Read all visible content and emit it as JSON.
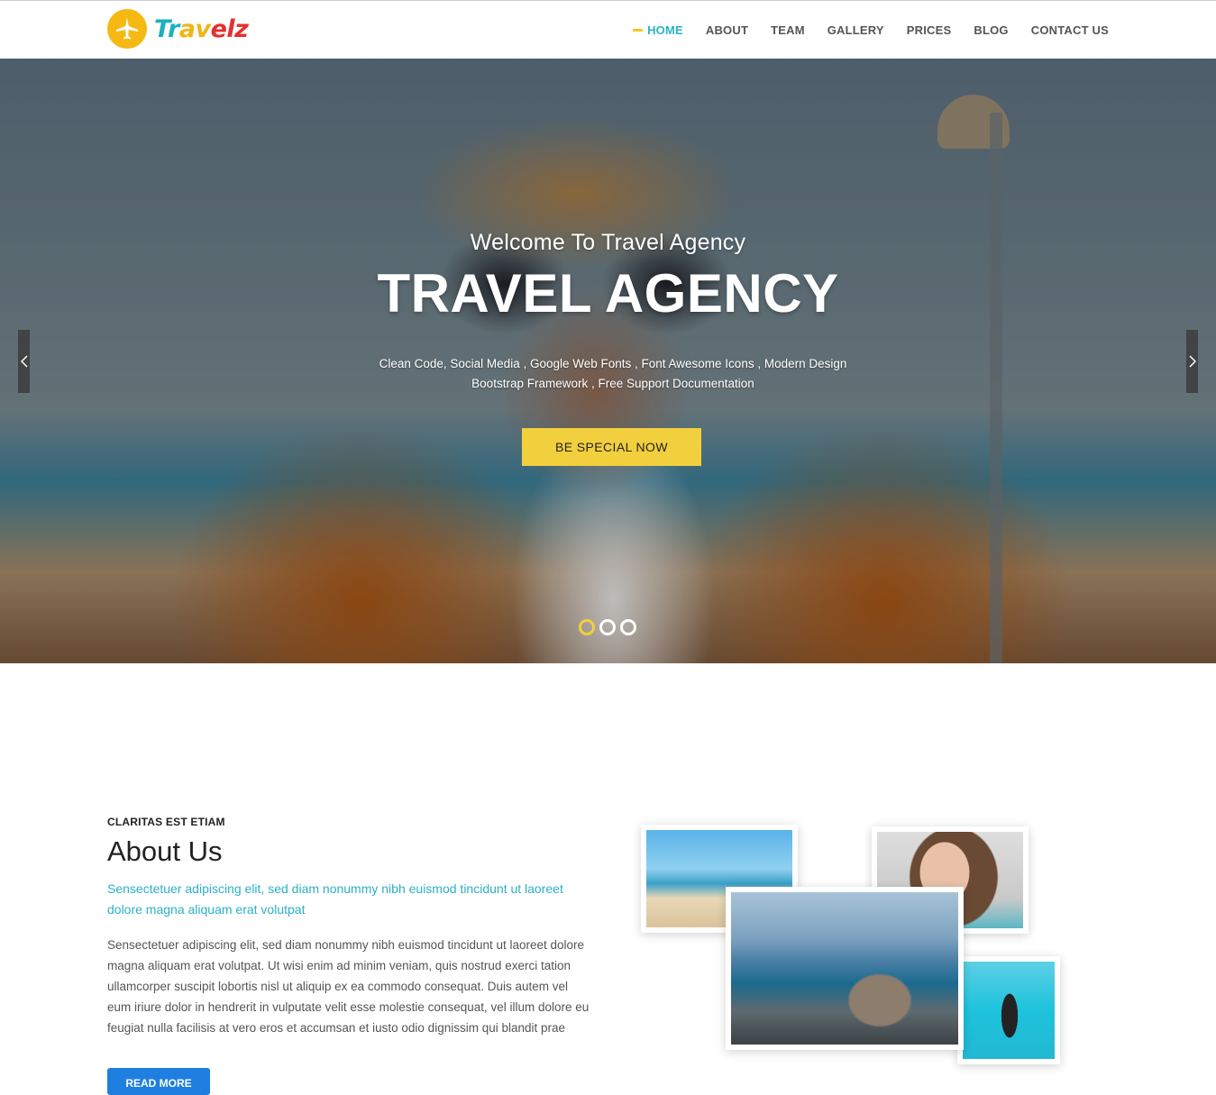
{
  "brand": {
    "name_part1": "Tr",
    "name_part2": "av",
    "name_part3": "elz",
    "colors": {
      "teal": "#19b1c0",
      "yellow": "#f0b515",
      "red": "#e5302f"
    }
  },
  "nav": {
    "items": [
      {
        "label": "HOME",
        "active": true
      },
      {
        "label": "ABOUT",
        "active": false
      },
      {
        "label": "TEAM",
        "active": false
      },
      {
        "label": "GALLERY",
        "active": false
      },
      {
        "label": "PRICES",
        "active": false
      },
      {
        "label": "BLOG",
        "active": false
      },
      {
        "label": "CONTACT US",
        "active": false
      }
    ],
    "active_color": "#2ab3c5"
  },
  "hero": {
    "subtitle": "Welcome To Travel Agency",
    "title": "TRAVEL AGENCY",
    "description": "Clean Code, Social Media , Google Web Fonts , Font Awesome Icons , Modern Design Bootstrap Framework , Free Support Documentation",
    "cta_label": "BE SPECIAL NOW",
    "cta_color": "#f2cf3c",
    "prev_icon": "chevron-left-icon",
    "next_icon": "chevron-right-icon",
    "slides_count": 3,
    "active_slide": 1
  },
  "about": {
    "kicker": "CLARITAS EST ETIAM",
    "title": "About Us",
    "lead": "Sensectetuer adipiscing elit, sed diam nonummy nibh euismod tincidunt ut laoreet dolore magna aliquam erat volutpat",
    "body": "Sensectetuer adipiscing elit, sed diam nonummy nibh euismod tincidunt ut laoreet dolore magna aliquam erat volutpat. Ut wisi enim ad minim veniam, quis nostrud exerci tation ullamcorper suscipit lobortis nisl ut aliquip ex ea commodo consequat. Duis autem vel eum iriure dolor in hendrerit in vulputate velit esse molestie consequat, vel illum dolore eu feugiat nulla facilisis at vero eros et accumsan et iusto odio dignissim qui blandit prae",
    "button_label": "READ MORE",
    "button_color": "#1f7fe0"
  }
}
